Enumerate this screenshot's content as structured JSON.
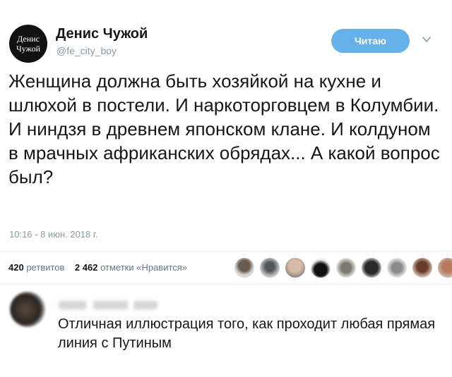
{
  "author": {
    "avatar_text_line1": "Денис",
    "avatar_text_line2": "Чужой",
    "name": "Денис Чужой",
    "handle": "@fe_city_boy"
  },
  "follow_button": {
    "label": "Читаю"
  },
  "icons": {
    "menu": "chevron-down-icon"
  },
  "tweet": {
    "text": "Женщина должна быть хозяйкой на кухне и шлюхой в постели. И наркоторговцем в Колумбии. И ниндзя в древнем японском клане. И колдуном в мрачных африканских обрядах... А какой вопрос был?",
    "timestamp": "10:16 - 8 июн. 2018 г."
  },
  "stats": {
    "retweets_count": "420",
    "retweets_label": "ретвитов",
    "likes_count": "2 462",
    "likes_label": "отметки «Нравится»"
  },
  "liker_avatars_count": 9,
  "reply": {
    "text": "Отличная иллюстрация того, как проходит любая прямая линия с Путиным"
  },
  "colors": {
    "accent": "#66b2e8",
    "secondary_text": "#8899a6",
    "divider": "#e6ecf0"
  }
}
